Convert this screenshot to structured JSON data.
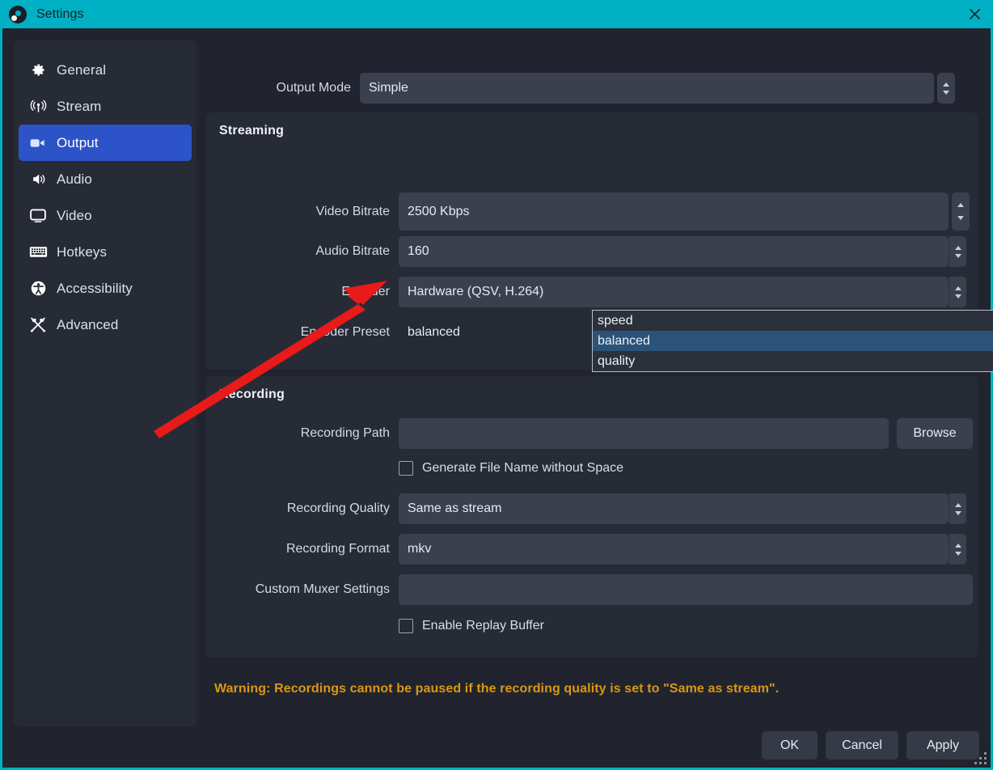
{
  "window": {
    "title": "Settings",
    "logo_icon": "obs-logo-icon",
    "close_icon": "close-icon",
    "accent_color": "#00b0c4",
    "background_color": "#21242e"
  },
  "sidebar": {
    "items": [
      {
        "label": "General",
        "icon": "gear-icon",
        "active": false
      },
      {
        "label": "Stream",
        "icon": "broadcast-icon",
        "active": false
      },
      {
        "label": "Output",
        "icon": "video-output-icon",
        "active": true
      },
      {
        "label": "Audio",
        "icon": "speaker-icon",
        "active": false
      },
      {
        "label": "Video",
        "icon": "monitor-icon",
        "active": false
      },
      {
        "label": "Hotkeys",
        "icon": "keyboard-icon",
        "active": false
      },
      {
        "label": "Accessibility",
        "icon": "accessibility-icon",
        "active": false
      },
      {
        "label": "Advanced",
        "icon": "tools-icon",
        "active": false
      }
    ],
    "active_color": "#2d53c8"
  },
  "output_mode": {
    "label": "Output Mode",
    "value": "Simple"
  },
  "streaming": {
    "title": "Streaming",
    "video_bitrate": {
      "label": "Video Bitrate",
      "value": "2500 Kbps"
    },
    "audio_bitrate": {
      "label": "Audio Bitrate",
      "value": "160"
    },
    "encoder": {
      "label": "Encoder",
      "value": "Hardware (QSV, H.264)"
    },
    "encoder_preset": {
      "label": "Encoder Preset",
      "value": "balanced",
      "open": true,
      "options": [
        "speed",
        "balanced",
        "quality"
      ],
      "selected_option": "balanced",
      "highlight_color": "#2b5279"
    }
  },
  "recording": {
    "title": "Recording",
    "recording_path": {
      "label": "Recording Path",
      "value": "",
      "placeholder": ""
    },
    "browse_button": "Browse",
    "generate_file_name": {
      "label": "Generate File Name without Space",
      "checked": false
    },
    "recording_quality": {
      "label": "Recording Quality",
      "value": "Same as stream"
    },
    "recording_format": {
      "label": "Recording Format",
      "value": "mkv"
    },
    "custom_muxer": {
      "label": "Custom Muxer Settings",
      "value": "",
      "placeholder": ""
    },
    "enable_replay_buffer": {
      "label": "Enable Replay Buffer",
      "checked": false
    }
  },
  "warning": {
    "text": "Warning: Recordings cannot be paused if the recording quality is set to \"Same as stream\".",
    "color": "#d99813"
  },
  "footer": {
    "ok": "OK",
    "cancel": "Cancel",
    "apply": "Apply"
  },
  "annotation": {
    "arrow_color": "#e81a1a",
    "points_at": "encoder-preset-dropdown"
  }
}
